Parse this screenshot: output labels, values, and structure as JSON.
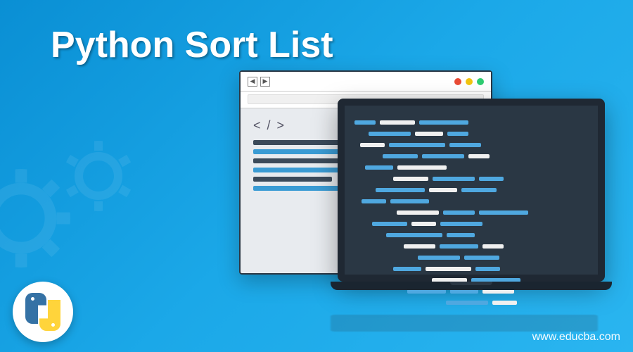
{
  "title": "Python Sort List",
  "watermark": "www.educba.com",
  "icons": {
    "nav_back": "◀",
    "nav_fwd": "▶",
    "code_tag": "< / >"
  },
  "colors": {
    "bg_gradient_start": "#0a8fd4",
    "bg_gradient_end": "#2ab5f0",
    "laptop_screen": "#2a3744",
    "accent_blue": "#4fa8e0",
    "accent_white": "#f0f0f0",
    "dot_red": "#e94b35",
    "dot_yellow": "#f1c40f",
    "dot_green": "#2ecc71",
    "python_blue": "#3572A5",
    "python_yellow": "#FFD43B"
  },
  "logo": {
    "name": "python-logo"
  }
}
